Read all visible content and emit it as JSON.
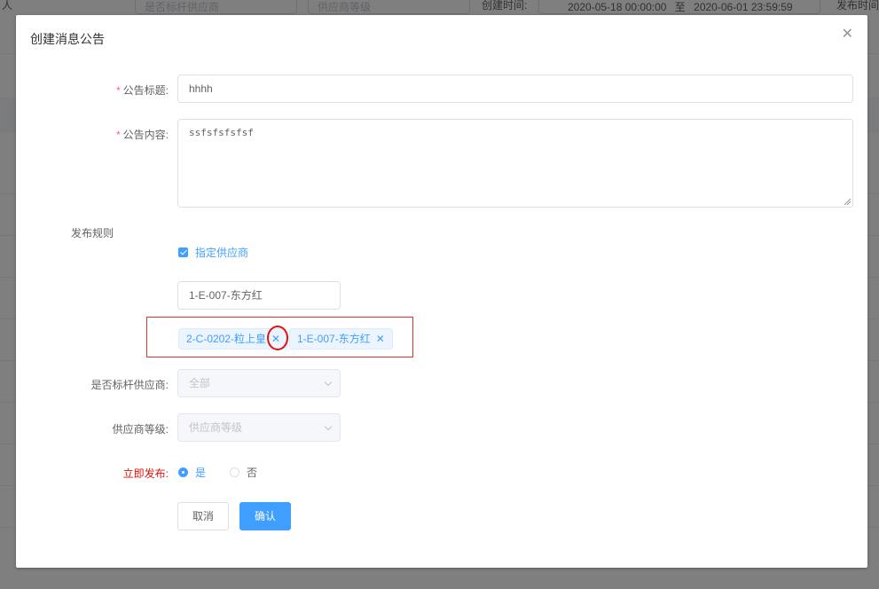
{
  "background": {
    "filters": {
      "person_label": "人",
      "benchmark_select": "是否标杆供应商",
      "grade_select": "供应商等级",
      "created_label": "创建时间:",
      "date_start": "2020-05-18 00:00:00",
      "date_sep": "至",
      "date_end": "2020-06-01 23:59:59",
      "publish_time_label": "发布时间"
    }
  },
  "dialog": {
    "title": "创建消息公告",
    "close_icon": "close-icon",
    "fields": {
      "title_label": "公告标题:",
      "title_value": "hhhh",
      "content_label": "公告内容:",
      "content_value": "ssfsfsfsfsf",
      "rule_label": "发布规则",
      "assign_supplier_checkbox": "指定供应商",
      "assign_supplier_checked": true,
      "supplier_input_value": "1-E-007-东方红",
      "selected_suppliers": [
        "2-C-0202-粒上皇",
        "1-E-007-东方红"
      ],
      "benchmark_label": "是否标杆供应商:",
      "benchmark_value": "全部",
      "grade_label": "供应商等级:",
      "grade_placeholder": "供应商等级",
      "publish_now_label": "立即发布:",
      "publish_now_options": [
        "是",
        "否"
      ],
      "publish_now_selected": "是"
    },
    "buttons": {
      "cancel": "取消",
      "confirm": "确认"
    },
    "colors": {
      "primary": "#409eff",
      "danger_label": "#e0120a",
      "required": "#f56c6c"
    }
  }
}
